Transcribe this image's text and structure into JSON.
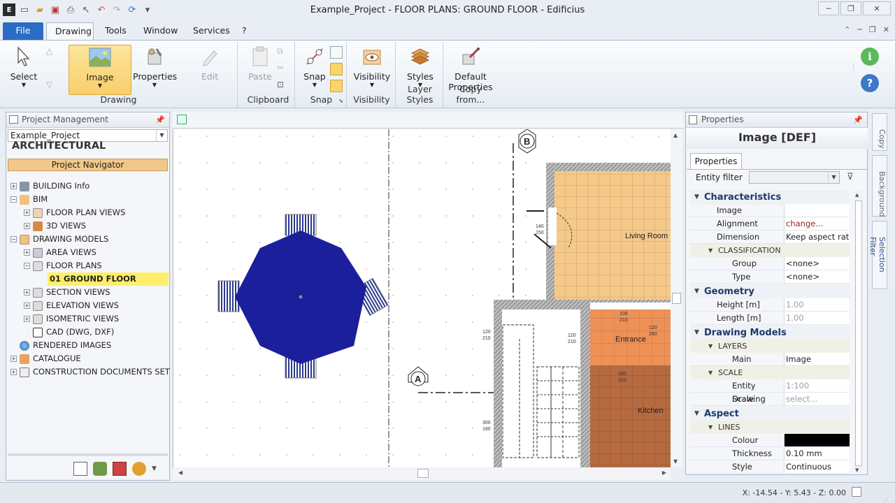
{
  "window": {
    "title": "Example_Project -  FLOOR PLANS: GROUND FLOOR - Edificius"
  },
  "ribbon_tabs": [
    "File",
    "Drawing",
    "Tools",
    "Window",
    "Services",
    "?"
  ],
  "ribbon": {
    "select": "Select",
    "image": "Image",
    "properties": "Properties",
    "edit": "Edit",
    "drawing_group": "Drawing",
    "paste": "Paste",
    "clipboard_group": "Clipboard",
    "snap": "Snap",
    "snap_group": "Snap",
    "visibility": "Visibility",
    "visibility_group": "Visibility",
    "styles": "Styles",
    "layer_styles_group": "Layer Styles",
    "default_properties_1": "Default",
    "default_properties_2": "Properties",
    "copy_from_group": "Copy from..."
  },
  "project_panel": {
    "header": "Project Management",
    "project_combo": "Example_Project",
    "section_title": "ARCHITECTURAL",
    "navigator": "Project Navigator",
    "tree": [
      {
        "label": "BUILDING Info"
      },
      {
        "label": "BIM"
      },
      {
        "label": "FLOOR PLAN VIEWS"
      },
      {
        "label": "3D VIEWS"
      },
      {
        "label": "DRAWING MODELS"
      },
      {
        "label": "AREA VIEWS"
      },
      {
        "label": "FLOOR PLANS"
      },
      {
        "label": "01 GROUND FLOOR"
      },
      {
        "label": "SECTION VIEWS"
      },
      {
        "label": "ELEVATION VIEWS"
      },
      {
        "label": "ISOMETRIC VIEWS"
      },
      {
        "label": "CAD (DWG, DXF)"
      },
      {
        "label": "RENDERED IMAGES"
      },
      {
        "label": "CATALOGUE"
      },
      {
        "label": "CONSTRUCTION DOCUMENTS SET"
      }
    ]
  },
  "canvas": {
    "marker_b": "B",
    "marker_a": "A",
    "rooms": {
      "living": "Living Room",
      "entrance": "Entrance",
      "kitchen": "Kitchen"
    },
    "dims": {
      "d1a": "140",
      "d1b": "150",
      "d2a": "120",
      "d2b": "210",
      "d3a": "120",
      "d3b": "210",
      "d4a": "120",
      "d4b": "280",
      "d5a": "100",
      "d5b": "210",
      "d6a": "300",
      "d6b": "180",
      "d7a": "180",
      "d7b": "210"
    }
  },
  "properties": {
    "header": "Properties",
    "title": "Image [DEF]",
    "tab": "Properties",
    "entity_filter": "Entity filter",
    "categories": {
      "characteristics": "Characteristics",
      "classification": "CLASSIFICATION",
      "geometry": "Geometry",
      "drawing_models": "Drawing Models",
      "layers": "LAYERS",
      "scale": "SCALE",
      "aspect": "Aspect",
      "lines": "LINES"
    },
    "rows": {
      "image": {
        "name": "Image",
        "value": ""
      },
      "alignment": {
        "name": "Alignment",
        "value": "change..."
      },
      "dimension": {
        "name": "Dimension",
        "value": "Keep aspect ratio"
      },
      "group": {
        "name": "Group",
        "value": "<none>"
      },
      "type": {
        "name": "Type",
        "value": "<none>"
      },
      "height": {
        "name": "Height  [m]",
        "value": "1.00"
      },
      "length": {
        "name": "Length  [m]",
        "value": "1.00"
      },
      "main": {
        "name": "Main",
        "value": "Image"
      },
      "entity_drawing": {
        "name": "Entity Drawing",
        "value": "1:100"
      },
      "scale_visibility": {
        "name": "Scale visibility",
        "value": "select..."
      },
      "colour": {
        "name": "Colour",
        "value": ""
      },
      "thickness": {
        "name": "Thickness",
        "value": "0.10 mm"
      },
      "style": {
        "name": "Style",
        "value": "Continuous"
      }
    }
  },
  "side_tabs": [
    "Copy",
    "Background",
    "Selection Filter"
  ],
  "status": {
    "coords": "X: -14.54 - Y: 5.43 - Z: 0.00"
  },
  "colors": {
    "accent": "#2b6cc4",
    "table_fill": "#1b1f9c",
    "living_fill": "#f4c98a",
    "entrance_fill": "#ee9157",
    "kitchen_fill": "#b66a3f",
    "highlight": "#ffee6a"
  }
}
